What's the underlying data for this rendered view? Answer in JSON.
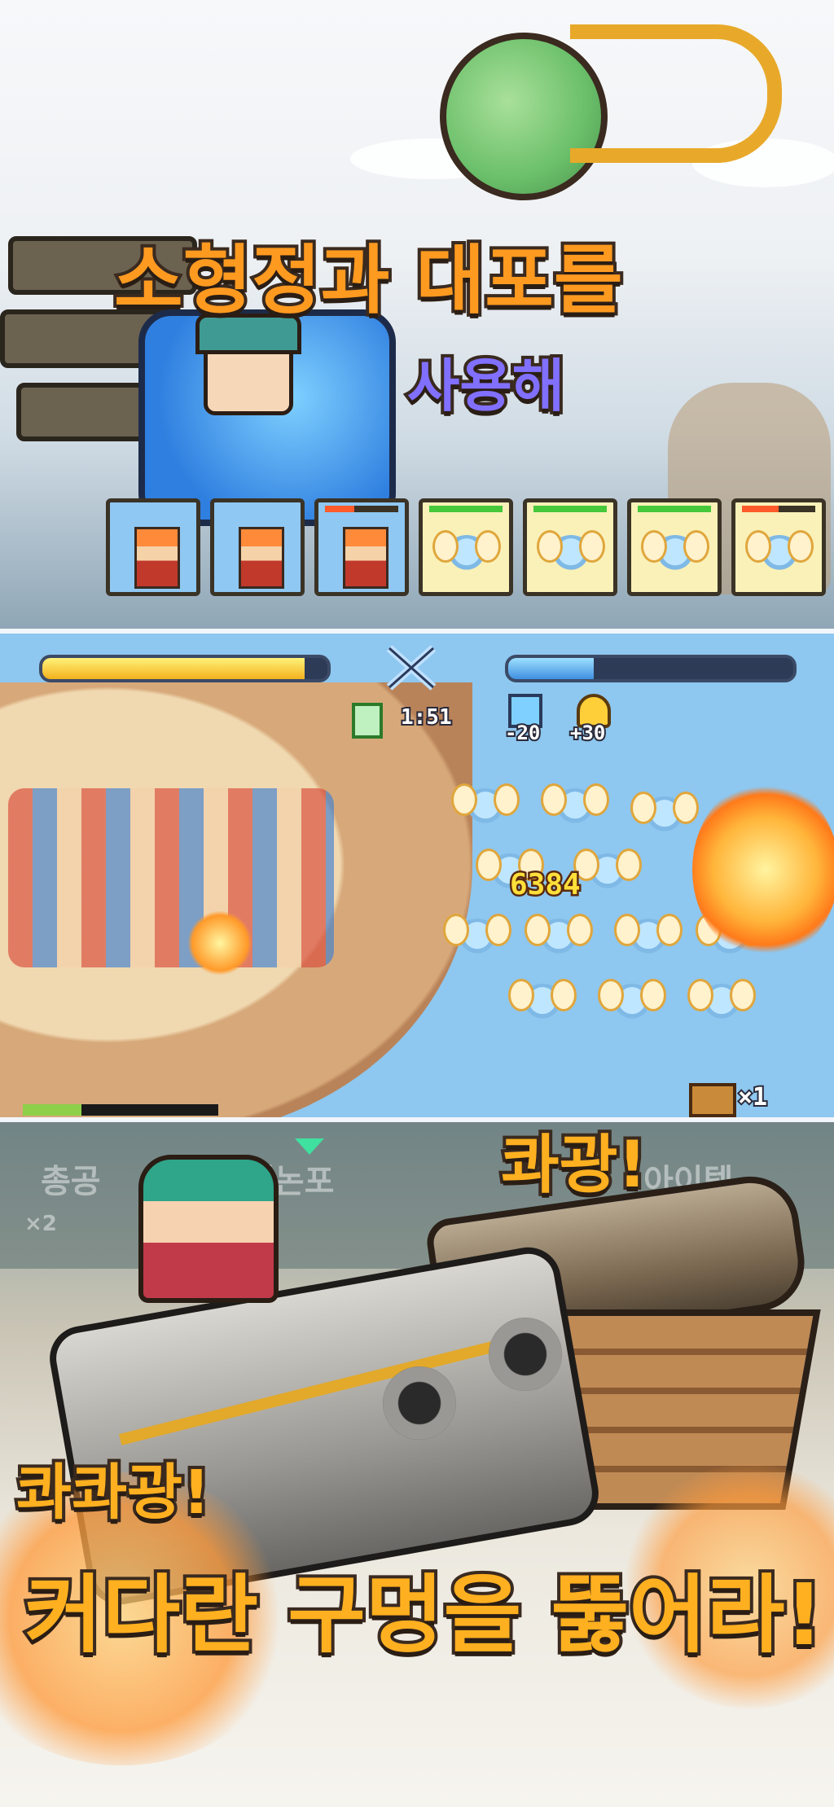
{
  "panel_top": {
    "headline_line1": "소형정과 대포를",
    "headline_line2": "사용해",
    "hud_slots": [
      {
        "kind": "crew",
        "icon": "red-haired-crew-icon"
      },
      {
        "kind": "crew",
        "icon": "pink-crew-icon"
      },
      {
        "kind": "crew",
        "icon": "orange-crew-icon",
        "hp": 0.4,
        "hp_low": true
      },
      {
        "kind": "fairy",
        "icon": "fairy-icon",
        "hp": 1.0
      },
      {
        "kind": "fairy",
        "icon": "fairy-icon",
        "hp": 1.0
      },
      {
        "kind": "fairy",
        "icon": "fairy-icon",
        "hp": 1.0
      },
      {
        "kind": "fairy",
        "icon": "fairy-icon",
        "hp": 0.5,
        "hp_low": true
      }
    ]
  },
  "panel_mid": {
    "player_hp": 0.92,
    "enemy_hp": 0.3,
    "timer": "1:51",
    "stat_left": "-20",
    "stat_right": "+30",
    "damage_number": "6384",
    "chest_count": "×1"
  },
  "panel_bottom": {
    "bang_top": "콰광!",
    "bang_left": "콰콰광!",
    "headline": "커다란 구멍을 뚫어라!",
    "faded_menu_left": "총공",
    "faded_menu_mid": "캐논포",
    "faded_menu_right": "아이템",
    "faded_counter": "×2"
  },
  "colors": {
    "headline_orange": "#ff9a20",
    "headline_purple": "#7f6cff",
    "outline_brown": "#3a2a1f",
    "sky_blue": "#8ec7ef"
  }
}
